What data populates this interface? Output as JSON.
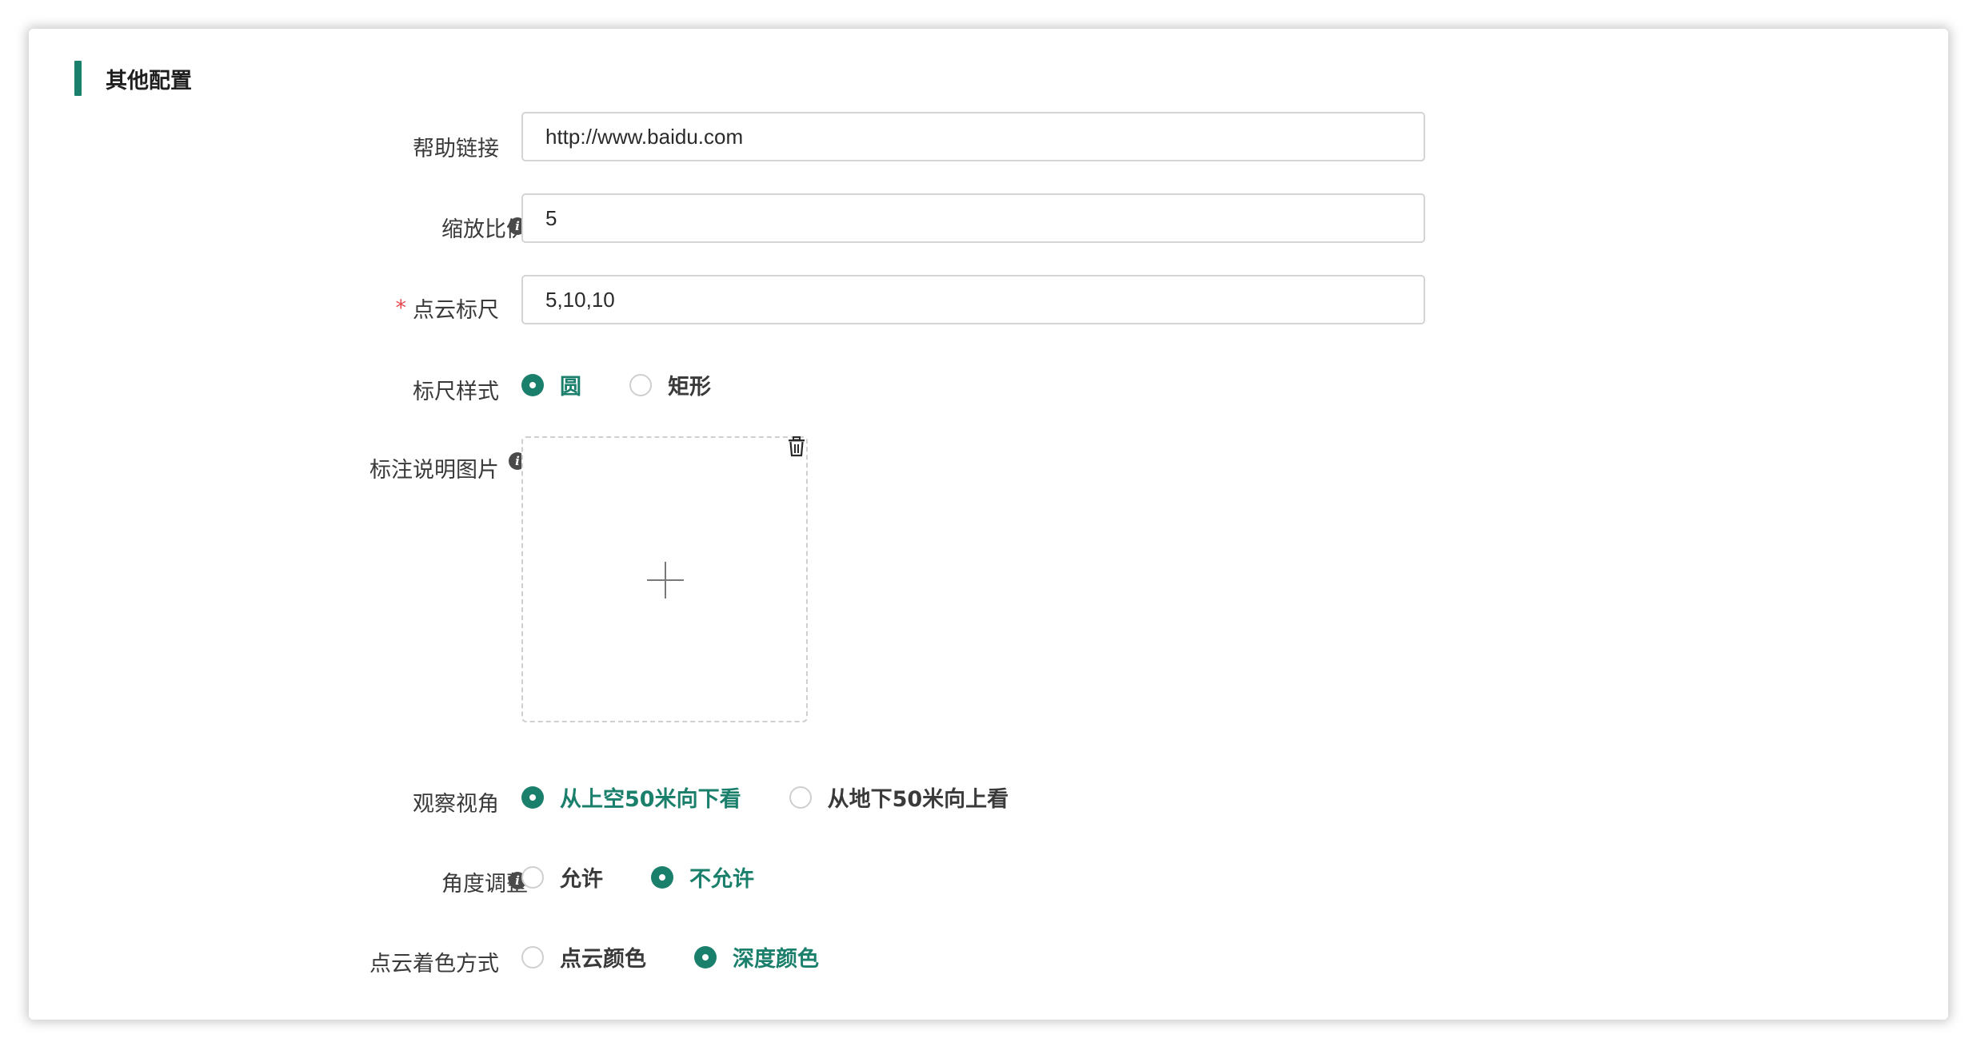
{
  "section": {
    "title": "其他配置"
  },
  "fields": {
    "help_link": {
      "label": "帮助链接",
      "value": "http://www.baidu.com"
    },
    "scale_ratio": {
      "label": "缩放比例",
      "value": "5",
      "icon": "info-icon"
    },
    "point_cloud_ruler": {
      "label": "点云标尺",
      "required_mark": "*",
      "value": "5,10,10"
    },
    "ruler_style": {
      "label": "标尺样式",
      "options": [
        "圆",
        "矩形"
      ],
      "selected": "圆"
    },
    "annotation_image": {
      "label": "标注说明图片",
      "icon": "info-icon",
      "upload_icon": "plus-icon",
      "delete_icon": "trash-icon"
    },
    "view_angle": {
      "label": "观察视角",
      "options": [
        "从上空50米向下看",
        "从地下50米向上看"
      ],
      "selected": "从上空50米向下看"
    },
    "angle_adjust": {
      "label": "角度调整",
      "icon": "info-icon",
      "options": [
        "允许",
        "不允许"
      ],
      "selected": "不允许"
    },
    "coloring_mode": {
      "label": "点云着色方式",
      "options": [
        "点云颜色",
        "深度颜色"
      ],
      "selected": "深度颜色"
    }
  },
  "colors": {
    "accent": "#1a7f6b",
    "required": "#e5484d"
  }
}
